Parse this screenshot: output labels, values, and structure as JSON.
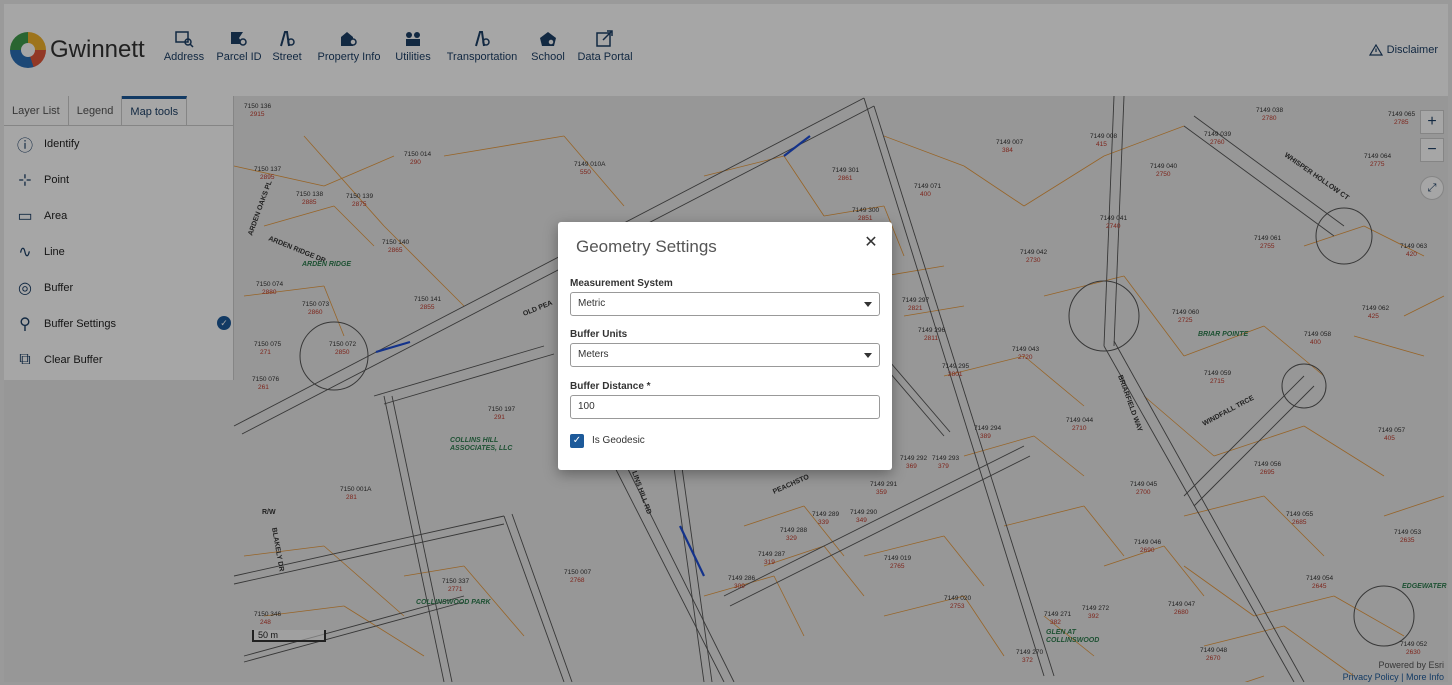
{
  "header": {
    "brand": "Gwinnett",
    "nav": [
      {
        "label": "Address",
        "icon": "address-search-icon"
      },
      {
        "label": "Parcel ID",
        "icon": "parcel-search-icon"
      },
      {
        "label": "Street",
        "icon": "street-search-icon"
      },
      {
        "label": "Property Info",
        "icon": "property-search-icon"
      },
      {
        "label": "Utilities",
        "icon": "utilities-icon"
      },
      {
        "label": "Transportation",
        "icon": "transportation-icon"
      },
      {
        "label": "School",
        "icon": "school-icon"
      },
      {
        "label": "Data Portal",
        "icon": "external-link-icon"
      }
    ],
    "disclaimer": "Disclaimer"
  },
  "panel": {
    "tabs": [
      "Layer List",
      "Legend",
      "Map tools"
    ],
    "active_tab": "Map tools",
    "tools": [
      "Identify",
      "Point",
      "Area",
      "Line",
      "Buffer",
      "Buffer Settings",
      "Clear Buffer"
    ],
    "checked_tool": "Buffer Settings"
  },
  "map": {
    "scale_label": "50 m",
    "powered_by": "Powered by Esri",
    "footer_privacy": "Privacy Policy",
    "footer_sep": "|",
    "footer_more": "More Info",
    "colors": {
      "parcel_line": "#e89a3c",
      "road_line": "#555555",
      "highlight": "#1f4fd6"
    },
    "parcels": [
      {
        "id": "7150 136",
        "num": "2915"
      },
      {
        "id": "7150 014",
        "num": "290"
      },
      {
        "id": "7149 010A",
        "num": "550"
      },
      {
        "id": "7150 137",
        "num": "2895"
      },
      {
        "id": "7150 138",
        "num": "2885"
      },
      {
        "id": "7150 139",
        "num": "2875"
      },
      {
        "id": "7150 140",
        "num": "2865"
      },
      {
        "id": "7150 074",
        "num": "2880"
      },
      {
        "id": "7150 073",
        "num": "2860"
      },
      {
        "id": "7150 141",
        "num": "2855"
      },
      {
        "id": "7150 075",
        "num": "271"
      },
      {
        "id": "7150 072",
        "num": "2850"
      },
      {
        "id": "7150 076",
        "num": "261"
      },
      {
        "id": "7150 197",
        "num": "291"
      },
      {
        "id": "7150 001A",
        "num": "281"
      },
      {
        "id": "7150 007",
        "num": "2768"
      },
      {
        "id": "7150 337",
        "num": "2771"
      },
      {
        "id": "7150 346",
        "num": "248"
      },
      {
        "id": "7149 301",
        "num": "2861"
      },
      {
        "id": "7149 300",
        "num": "2851"
      },
      {
        "id": "7149 071",
        "num": "400"
      },
      {
        "id": "7149 007",
        "num": "384"
      },
      {
        "id": "7149 008",
        "num": "415"
      },
      {
        "id": "7149 039",
        "num": "2760"
      },
      {
        "id": "7149 038",
        "num": "2780"
      },
      {
        "id": "7149 065",
        "num": "2785"
      },
      {
        "id": "7149 040",
        "num": "2750"
      },
      {
        "id": "7149 064",
        "num": "2775"
      },
      {
        "id": "7149 041",
        "num": "2740"
      },
      {
        "id": "7149 042",
        "num": "2730"
      },
      {
        "id": "7149 061",
        "num": "2755"
      },
      {
        "id": "7149 063",
        "num": "420"
      },
      {
        "id": "7149 297",
        "num": "2821"
      },
      {
        "id": "7149 296",
        "num": "2811"
      },
      {
        "id": "7149 295",
        "num": "2801"
      },
      {
        "id": "7149 043",
        "num": "2720"
      },
      {
        "id": "7149 060",
        "num": "2725"
      },
      {
        "id": "7149 062",
        "num": "425"
      },
      {
        "id": "7149 058",
        "num": "400"
      },
      {
        "id": "7149 059",
        "num": "2715"
      },
      {
        "id": "7149 294",
        "num": "389"
      },
      {
        "id": "7149 044",
        "num": "2710"
      },
      {
        "id": "7149 057",
        "num": "405"
      },
      {
        "id": "7149 292",
        "num": "369"
      },
      {
        "id": "7149 293",
        "num": "379"
      },
      {
        "id": "7149 291",
        "num": "359"
      },
      {
        "id": "7149 056",
        "num": "2695"
      },
      {
        "id": "7149 045",
        "num": "2700"
      },
      {
        "id": "7149 290",
        "num": "349"
      },
      {
        "id": "7149 289",
        "num": "339"
      },
      {
        "id": "7149 288",
        "num": "329"
      },
      {
        "id": "7149 287",
        "num": "319"
      },
      {
        "id": "7149 055",
        "num": "2685"
      },
      {
        "id": "7149 053",
        "num": "2635"
      },
      {
        "id": "7149 046",
        "num": "2690"
      },
      {
        "id": "7149 019",
        "num": "2765"
      },
      {
        "id": "7149 286",
        "num": "309"
      },
      {
        "id": "7149 054",
        "num": "2645"
      },
      {
        "id": "7149 020",
        "num": "2753"
      },
      {
        "id": "7149 047",
        "num": "2680"
      },
      {
        "id": "7149 271",
        "num": "382"
      },
      {
        "id": "7149 272",
        "num": "392"
      },
      {
        "id": "7149 048",
        "num": "2670"
      },
      {
        "id": "7149 052",
        "num": "2630"
      },
      {
        "id": "7149 270",
        "num": "372"
      }
    ],
    "streets": [
      "ARDEN RIDGE DR",
      "ARDEN OAKS PL",
      "OLD PEA",
      "WHISPER HOLLOW CT",
      "BRIARFIELD WAY",
      "WINDFALL TRCE",
      "PEACHSTO",
      "LINS HILL RD",
      "BLAKELY DR",
      "R/W"
    ],
    "areas": [
      "ARDEN RIDGE",
      "COLLINS HILL ASSOCIATES, LLC",
      "BRIAR POINTE",
      "COLLINSWOOD PARK",
      "GLEN AT COLLINSWOOD",
      "EDGEWATER"
    ]
  },
  "modal": {
    "title": "Geometry Settings",
    "measurement_label": "Measurement System",
    "measurement_value": "Metric",
    "units_label": "Buffer Units",
    "units_value": "Meters",
    "distance_label": "Buffer Distance *",
    "distance_value": "100",
    "geodesic_label": "Is Geodesic",
    "geodesic_checked": true
  }
}
